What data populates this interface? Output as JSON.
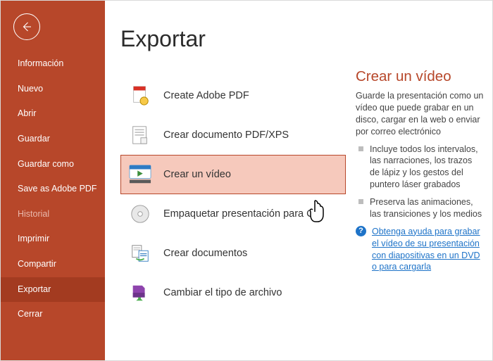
{
  "sidebar": {
    "items": [
      {
        "label": "Información"
      },
      {
        "label": "Nuevo"
      },
      {
        "label": "Abrir"
      },
      {
        "label": "Guardar"
      },
      {
        "label": "Guardar como"
      },
      {
        "label": "Save as Adobe PDF"
      },
      {
        "label": "Historial"
      },
      {
        "label": "Imprimir"
      },
      {
        "label": "Compartir"
      },
      {
        "label": "Exportar"
      },
      {
        "label": "Cerrar"
      }
    ]
  },
  "page": {
    "title": "Exportar"
  },
  "options": [
    {
      "label": "Create Adobe PDF"
    },
    {
      "label": "Crear documento PDF/XPS"
    },
    {
      "label": "Crear un vídeo"
    },
    {
      "label": "Empaquetar presentación para CD"
    },
    {
      "label": "Crear documentos"
    },
    {
      "label": "Cambiar el tipo de archivo"
    }
  ],
  "panel": {
    "title": "Crear un vídeo",
    "intro": "Guarde la presentación como un vídeo que puede grabar en un disco, cargar en la web o enviar por correo electrónico",
    "bullets": [
      "Incluye todos los intervalos, las narraciones, los trazos de lápiz y los gestos del puntero láser grabados",
      "Preserva las animaciones, las transiciones y los medios"
    ],
    "help": "Obtenga ayuda para grabar el vídeo de su presentación con diapositivas en un DVD o para cargarla"
  }
}
